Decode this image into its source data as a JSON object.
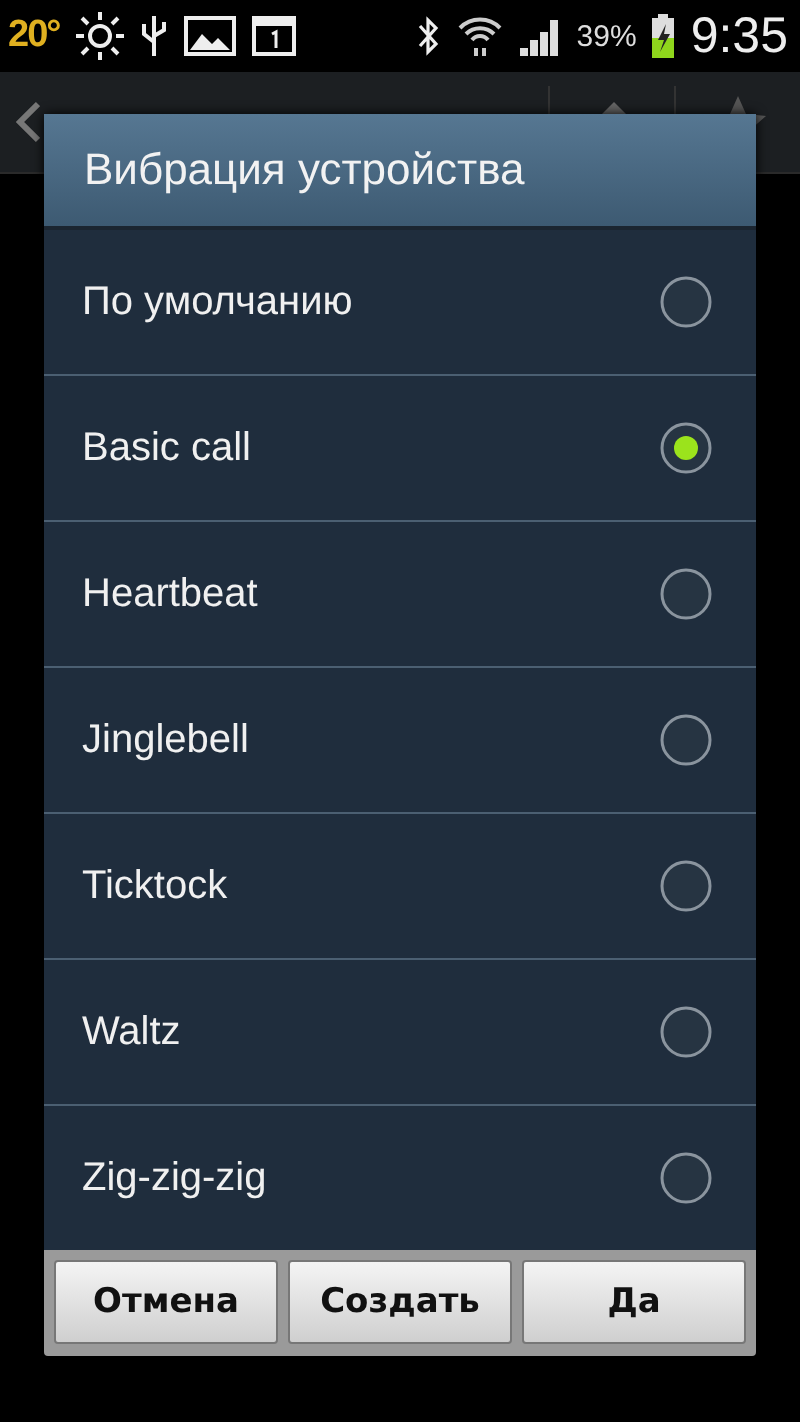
{
  "status_bar": {
    "temperature": "20°",
    "battery_percent": "39%",
    "time": "9:35"
  },
  "dialog": {
    "title": "Вибрация устройства",
    "options": [
      {
        "label": "По умолчанию",
        "selected": false
      },
      {
        "label": "Basic call",
        "selected": true
      },
      {
        "label": "Heartbeat",
        "selected": false
      },
      {
        "label": "Jinglebell",
        "selected": false
      },
      {
        "label": "Ticktock",
        "selected": false
      },
      {
        "label": "Waltz",
        "selected": false
      },
      {
        "label": "Zig-zig-zig",
        "selected": false
      }
    ],
    "buttons": [
      "Отмена",
      "Создать",
      "Да"
    ]
  }
}
